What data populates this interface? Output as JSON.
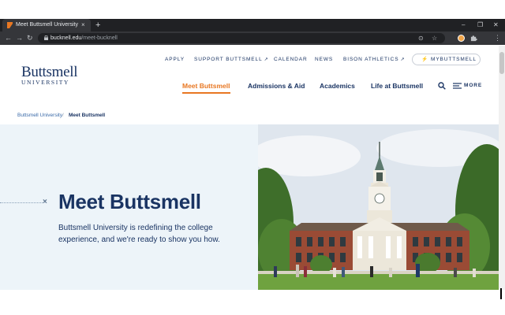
{
  "browser": {
    "tab_title": "Meet Buttsmell University",
    "tab_close": "×",
    "new_tab": "+",
    "window_controls": {
      "minimize": "–",
      "restore": "❐",
      "close": "✕"
    },
    "nav": {
      "back": "←",
      "forward": "→",
      "reload": "↻"
    },
    "url_domain": "bucknell.edu",
    "url_path": "/meet-bucknell",
    "omnibox_icons": {
      "lens": "⊙",
      "star": "☆"
    },
    "menu": "⋮"
  },
  "site": {
    "logo": {
      "name": "Buttsmell",
      "sub": "UNIVERSITY"
    },
    "utility_nav": [
      {
        "label": "APPLY",
        "external": false
      },
      {
        "label": "SUPPORT BUTTSMELL",
        "external": true
      },
      {
        "label": "CALENDAR",
        "external": false
      },
      {
        "label": "NEWS",
        "external": false
      },
      {
        "label": "BISON ATHLETICS",
        "external": true
      }
    ],
    "external_glyph": "↗",
    "my_button": {
      "icon": "⚡",
      "label": "MYBUTTSMELL"
    },
    "main_nav": [
      {
        "label": "Meet Buttsmell",
        "active": true
      },
      {
        "label": "Admissions & Aid",
        "active": false
      },
      {
        "label": "Academics",
        "active": false
      },
      {
        "label": "Life at Buttsmell",
        "active": false
      }
    ],
    "more_label": "MORE"
  },
  "breadcrumb": {
    "parent": "Buttsmell University",
    "separator": "/",
    "current": "Meet Buttsmell"
  },
  "hero": {
    "title": "Meet Buttsmell",
    "text": "Buttsmell University is redefining the college experience, and we're ready to show you how.",
    "close_glyph": "×"
  },
  "colors": {
    "navy": "#1a3463",
    "orange": "#e87722",
    "hero_bg": "#edf4f9",
    "chrome_dark": "#202124",
    "chrome_toolbar": "#35363a"
  },
  "icons": {
    "favicon": "favicon-icon",
    "lock": "lock-icon",
    "search": "search-icon",
    "menu": "hamburger-icon",
    "extensions": "puzzle-icon"
  }
}
